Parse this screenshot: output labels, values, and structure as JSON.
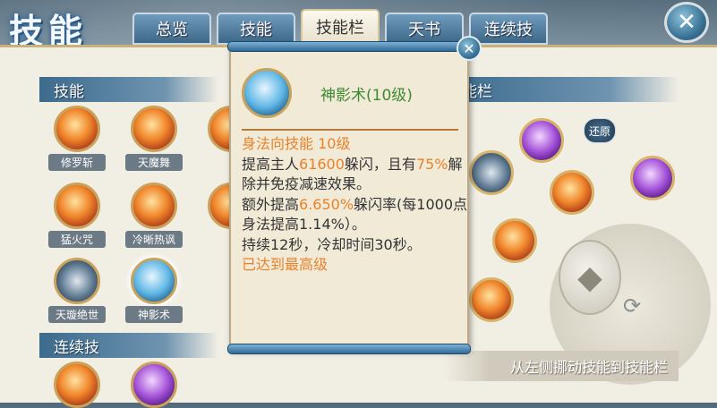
{
  "title": "技能",
  "tabs": [
    {
      "label": "总览",
      "active": false
    },
    {
      "label": "技能",
      "active": false
    },
    {
      "label": "技能栏",
      "active": true
    },
    {
      "label": "天书",
      "active": false
    },
    {
      "label": "连续技",
      "active": false
    }
  ],
  "sections": {
    "skills_header": "技能",
    "combo_header": "连续技",
    "bar_header": "能栏"
  },
  "skills": [
    {
      "name": "修罗斩",
      "icon": "fire-slash-icon"
    },
    {
      "name": "天魔舞",
      "icon": "fire-dance-icon"
    },
    {
      "name": "猛火咒",
      "icon": "fire-curse-icon"
    },
    {
      "name": "冷晰热讽",
      "icon": "fire-burst-icon"
    },
    {
      "name": "天璇绝世",
      "icon": "wheel-icon"
    },
    {
      "name": "神影术",
      "icon": "ice-swirl-icon"
    }
  ],
  "skill_bar": {
    "reset_label": "还原",
    "hint": "从左侧挪动技能到技能栏"
  },
  "tooltip": {
    "name": "神影术(10级)",
    "type_line": "身法向技能  10级",
    "desc_1a": "提高主人",
    "desc_1b": "61600",
    "desc_1c": "躲闪，且有",
    "desc_1d": "75%",
    "desc_1e": "解除并免疫减速效果。",
    "desc_2a": "额外提高",
    "desc_2b": "6.650%",
    "desc_2c": "躲闪率(每1000点身法提高1.14%）。",
    "desc_3": "持续12秒，冷却时间30秒。",
    "status": "已达到最高级"
  },
  "colors": {
    "tab_blue": "#3d6787",
    "highlight_orange": "#e9822b",
    "skill_name_green": "#3f8a33"
  }
}
